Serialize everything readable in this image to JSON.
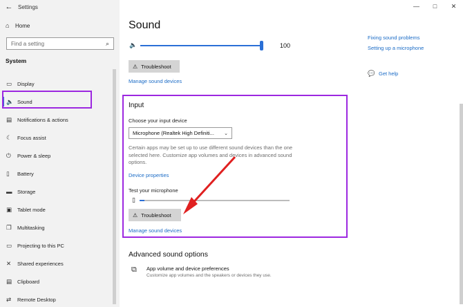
{
  "window": {
    "title": "Settings",
    "controls": [
      "—",
      "□",
      "✕"
    ]
  },
  "sidebar": {
    "home_label": "Home",
    "search_placeholder": "Find a setting",
    "section_label": "System",
    "items": [
      {
        "label": "Display",
        "icon": "display-icon"
      },
      {
        "label": "Sound",
        "icon": "speaker-icon",
        "selected": true
      },
      {
        "label": "Notifications & actions",
        "icon": "notification-icon"
      },
      {
        "label": "Focus assist",
        "icon": "moon-icon"
      },
      {
        "label": "Power & sleep",
        "icon": "power-icon"
      },
      {
        "label": "Battery",
        "icon": "battery-icon"
      },
      {
        "label": "Storage",
        "icon": "storage-icon"
      },
      {
        "label": "Tablet mode",
        "icon": "tablet-icon"
      },
      {
        "label": "Multitasking",
        "icon": "multitasking-icon"
      },
      {
        "label": "Projecting to this PC",
        "icon": "projector-icon"
      },
      {
        "label": "Shared experiences",
        "icon": "share-icon"
      },
      {
        "label": "Clipboard",
        "icon": "clipboard-icon"
      },
      {
        "label": "Remote Desktop",
        "icon": "remote-desktop-icon"
      }
    ]
  },
  "main": {
    "title": "Sound",
    "output": {
      "volume": 100,
      "volume_label": "100",
      "troubleshoot_label": "Troubleshoot",
      "manage_link": "Manage sound devices"
    },
    "input": {
      "heading": "Input",
      "choose_label": "Choose your input device",
      "device_selected": "Microphone (Realtek High Definiti...",
      "description": "Certain apps may be set up to use different sound devices than the one selected here. Customize app volumes and devices in advanced sound options.",
      "device_properties_link": "Device properties",
      "test_label": "Test your microphone",
      "mic_level": 0.03,
      "troubleshoot_label": "Troubleshoot",
      "manage_link": "Manage sound devices"
    },
    "advanced": {
      "heading": "Advanced sound options",
      "item_title": "App volume and device preferences",
      "item_sub": "Customize app volumes and the speakers or devices they use."
    }
  },
  "related": {
    "links": [
      "Fixing sound problems",
      "Setting up a microphone"
    ],
    "help_label": "Get help"
  },
  "colors": {
    "accent": "#2a6fd6",
    "highlight": "#9c27e0",
    "annotation_arrow": "#e02020"
  }
}
